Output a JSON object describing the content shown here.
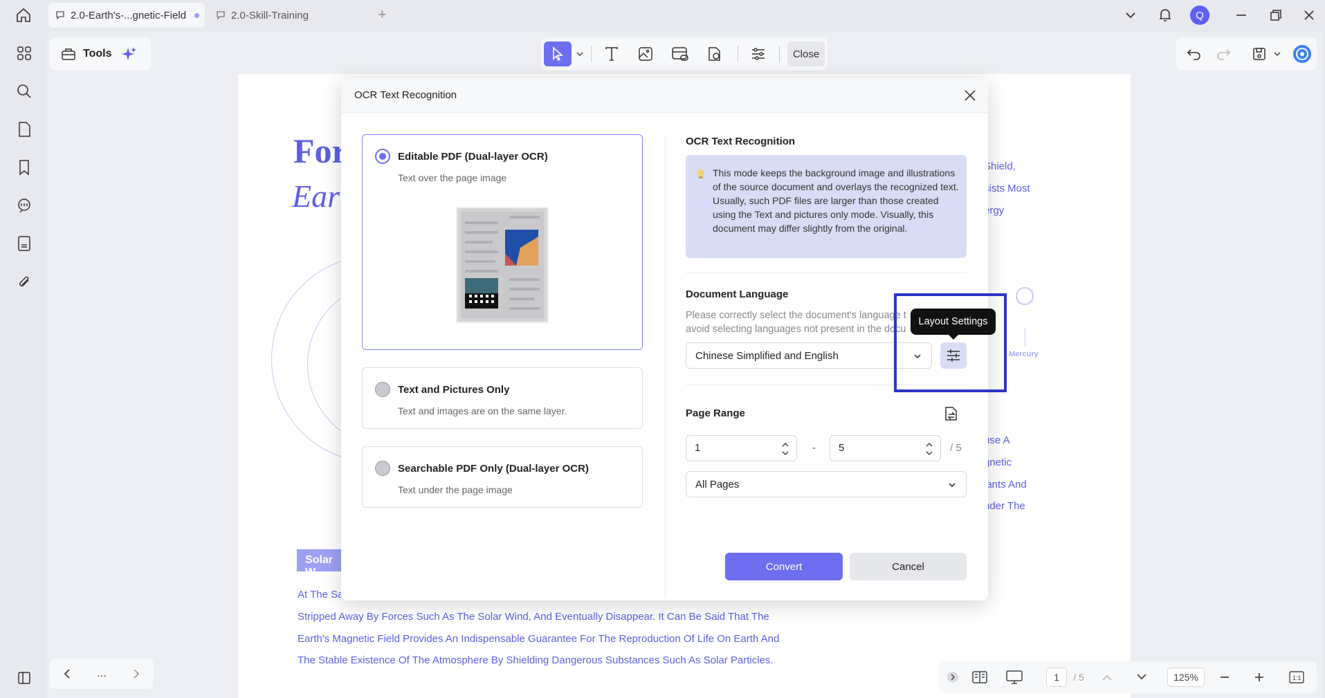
{
  "tabs": [
    {
      "label": "2.0-Earth's-...gnetic-Field",
      "active": true,
      "unsaved": true
    },
    {
      "label": "2.0-Skill-Training",
      "active": false
    }
  ],
  "account": {
    "avatar_letter": "Q",
    "accent": "#5b5ff2"
  },
  "toolbar": {
    "tools_label": "Tools",
    "close_label": "Close"
  },
  "document": {
    "title_line1": "For",
    "title_line2": "Ear",
    "side_text": [
      "Shield,",
      "sists Most",
      "ergy"
    ],
    "side_text2": [
      "use A",
      "gnetic",
      "lants And",
      "nder The"
    ],
    "planet_label": "Mercury",
    "badge": "Solar W",
    "paragraph": [
      "At The Sa",
      "Stripped Away By Forces Such As The Solar Wind, And Eventually Disappear. It Can Be Said That The",
      "Earth's Magnetic Field Provides An Indispensable Guarantee For The Reproduction Of Life On Earth And",
      "The Stable Existence Of The Atmosphere By Shielding Dangerous Substances Such As Solar Particles."
    ]
  },
  "dialog": {
    "title": "OCR Text Recognition",
    "options": [
      {
        "title": "Editable PDF (Dual-layer OCR)",
        "desc": "Text over the page image",
        "selected": true
      },
      {
        "title": "Text and Pictures Only",
        "desc": "Text and images are on the same layer.",
        "selected": false
      },
      {
        "title": "Searchable PDF Only (Dual-layer OCR)",
        "desc": "Text under the page image",
        "selected": false
      }
    ],
    "info_title": "OCR Text Recognition",
    "info_text": "This mode keeps the background image and illustrations of the source document and overlays the recognized text. Usually, such PDF files are larger than those created using the Text and pictures only mode. Visually, this document may differ slightly from the original.",
    "lang_title": "Document Language",
    "lang_desc": "Please correctly select the document's language t avoid selecting languages not present in the docu",
    "lang_value": "Chinese Simplified and English",
    "tooltip": "Layout Settings",
    "range_title": "Page Range",
    "range_from": "1",
    "range_to": "5",
    "range_total": "/ 5",
    "range_sep": "-",
    "pages_value": "All Pages",
    "convert_label": "Convert",
    "cancel_label": "Cancel"
  },
  "statusbar": {
    "more": "...",
    "page_current": "1",
    "page_total": "/ 5",
    "zoom": "125%"
  },
  "colors": {
    "accent": "#6c6ff0",
    "doc_text": "#5b5fe4",
    "highlight_box": "#2c35c8"
  }
}
